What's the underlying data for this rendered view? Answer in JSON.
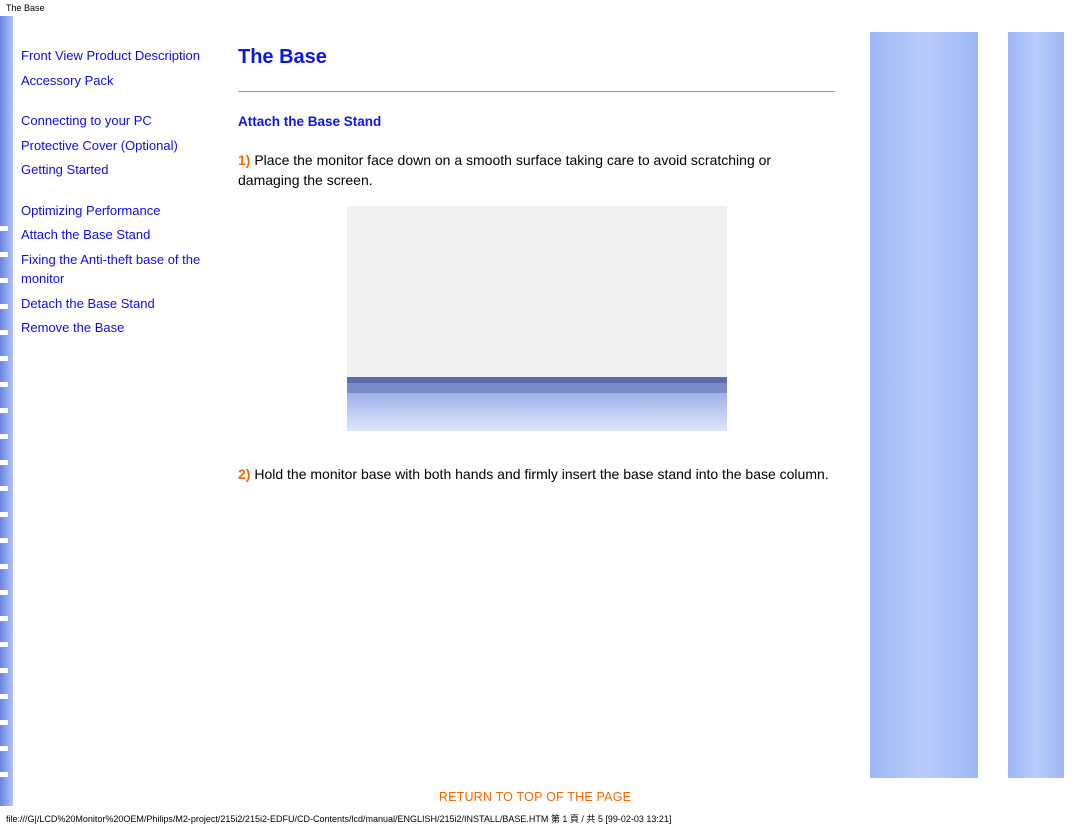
{
  "top_bar": "The Base",
  "sidebar": {
    "links": [
      {
        "label": "Front View Product Description"
      },
      {
        "label": "Accessory Pack"
      },
      {
        "label": "Connecting to your PC"
      },
      {
        "label": "Protective Cover (Optional)"
      },
      {
        "label": "Getting Started"
      },
      {
        "label": "Optimizing Performance"
      },
      {
        "label": "Attach the Base Stand"
      },
      {
        "label": "Fixing the Anti-theft base of the monitor"
      },
      {
        "label": "Detach the Base Stand"
      },
      {
        "label": "Remove the Base"
      }
    ]
  },
  "main": {
    "title": "The Base",
    "subhead": "Attach the Base Stand",
    "steps": [
      {
        "num": "1)",
        "text": " Place the monitor face down on a smooth surface taking care to avoid scratching or damaging the screen."
      },
      {
        "num": "2)",
        "text": " Hold the monitor base with both hands and firmly insert the base stand into the base column."
      }
    ],
    "return_link": "RETURN TO TOP OF THE PAGE"
  },
  "footer": "file:///G|/LCD%20Monitor%20OEM/Philips/M2-project/215i2/215i2-EDFU/CD-Contents/lcd/manual/ENGLISH/215i2/INSTALL/BASE.HTM 第 1 頁 / 共 5 [99-02-03 13:21]"
}
